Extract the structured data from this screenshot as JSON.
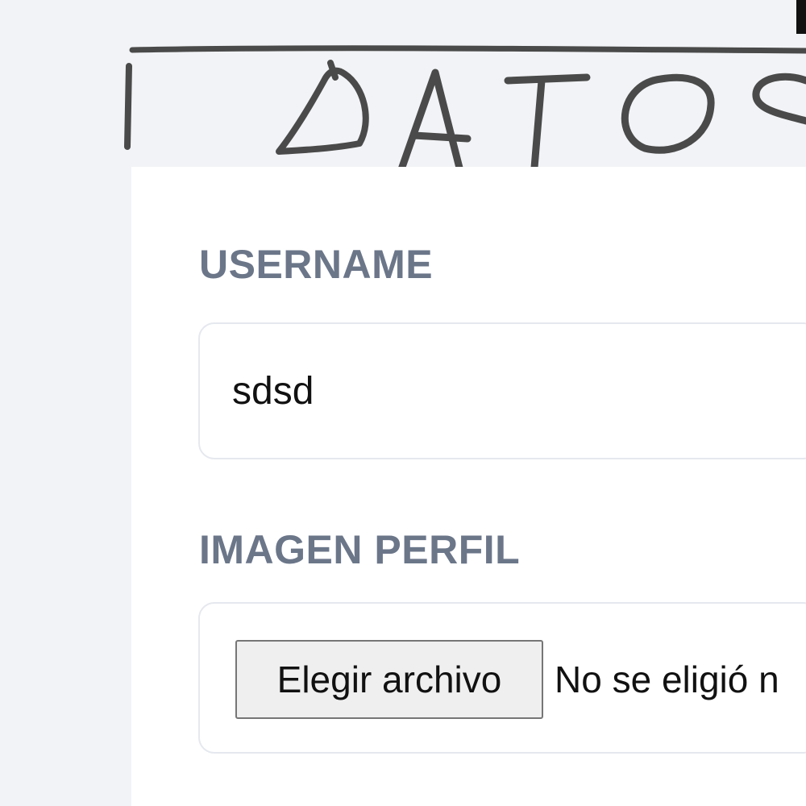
{
  "header": {
    "handwritten_title": "DATOS"
  },
  "form": {
    "username": {
      "label": "USERNAME",
      "value": "sdsd"
    },
    "profile_image": {
      "label": "IMAGEN PERFIL",
      "button_label": "Elegir archivo",
      "status_text": "No se eligió n"
    }
  },
  "colors": {
    "page_background": "#f2f3f6",
    "card_background": "#ffffff",
    "label_text": "#6b7689",
    "input_border": "#e5e8ee",
    "button_background": "#efefef",
    "sketch_stroke": "#4a4a4a"
  }
}
